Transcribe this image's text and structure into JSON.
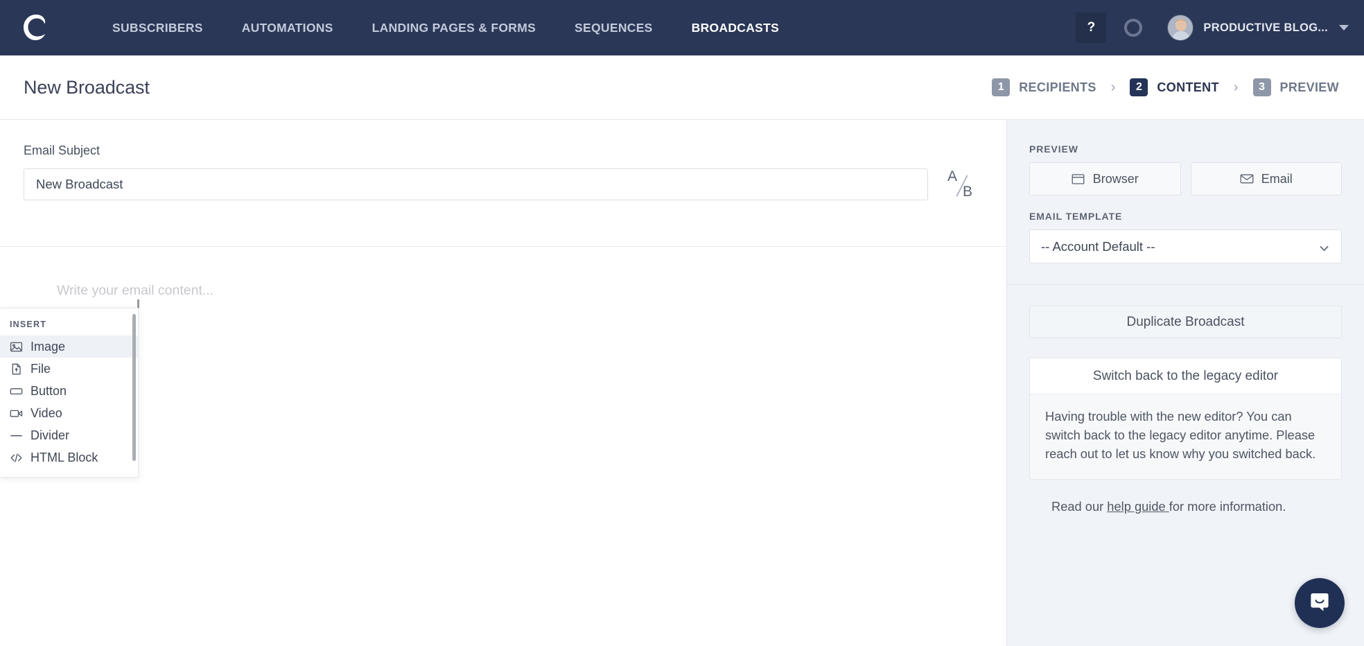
{
  "topnav": {
    "logo_icon": "convertkit-logo-icon",
    "items": [
      {
        "label": "SUBSCRIBERS",
        "active": false
      },
      {
        "label": "AUTOMATIONS",
        "active": false
      },
      {
        "label": "LANDING PAGES & FORMS",
        "active": false
      },
      {
        "label": "SEQUENCES",
        "active": false
      },
      {
        "label": "BROADCASTS",
        "active": true
      }
    ],
    "help_label": "?",
    "notifications_icon": "ring-icon",
    "account_name": "PRODUCTIVE BLOG...",
    "avatar_icon": "user-avatar",
    "accent_color": "#ef6b72",
    "bg_color": "#2b3757"
  },
  "pagehead": {
    "title": "New Broadcast",
    "steps": [
      {
        "number": "1",
        "label": "RECIPIENTS",
        "active": false
      },
      {
        "number": "2",
        "label": "CONTENT",
        "active": true
      },
      {
        "number": "3",
        "label": "PREVIEW",
        "active": false
      }
    ],
    "separator": "›"
  },
  "editor": {
    "subject_label": "Email Subject",
    "subject_value": "New Broadcast",
    "subject_placeholder": "Email Subject",
    "ab_test": {
      "a": "A",
      "b": "B"
    },
    "content_placeholder": "Write your email content..."
  },
  "insert_menu": {
    "title": "INSERT",
    "items": [
      {
        "label": "Image",
        "icon": "image-icon",
        "hovered": true
      },
      {
        "label": "File",
        "icon": "file-upload-icon",
        "hovered": false
      },
      {
        "label": "Button",
        "icon": "button-icon",
        "hovered": false
      },
      {
        "label": "Video",
        "icon": "video-icon",
        "hovered": false
      },
      {
        "label": "Divider",
        "icon": "divider-icon",
        "hovered": false
      },
      {
        "label": "HTML Block",
        "icon": "code-icon",
        "hovered": false
      }
    ]
  },
  "sidebar": {
    "preview_label": "PREVIEW",
    "preview_buttons": [
      {
        "label": "Browser",
        "icon": "browser-window-icon"
      },
      {
        "label": "Email",
        "icon": "envelope-icon"
      }
    ],
    "template_label": "EMAIL TEMPLATE",
    "template_value": "-- Account Default --",
    "template_options": [
      "-- Account Default --"
    ],
    "duplicate_label": "Duplicate Broadcast",
    "legacy_button_label": "Switch back to the legacy editor",
    "legacy_body": "Having trouble with the new editor? You can switch back to the legacy editor anytime. Please reach out to let us know why you switched back.",
    "readmore_prefix": "Read our ",
    "readmore_link": "help guide ",
    "readmore_suffix": "for more information.",
    "bg_color": "#f0f3f7"
  },
  "intercom": {
    "icon": "chat-bubble-icon",
    "color": "#203055"
  }
}
